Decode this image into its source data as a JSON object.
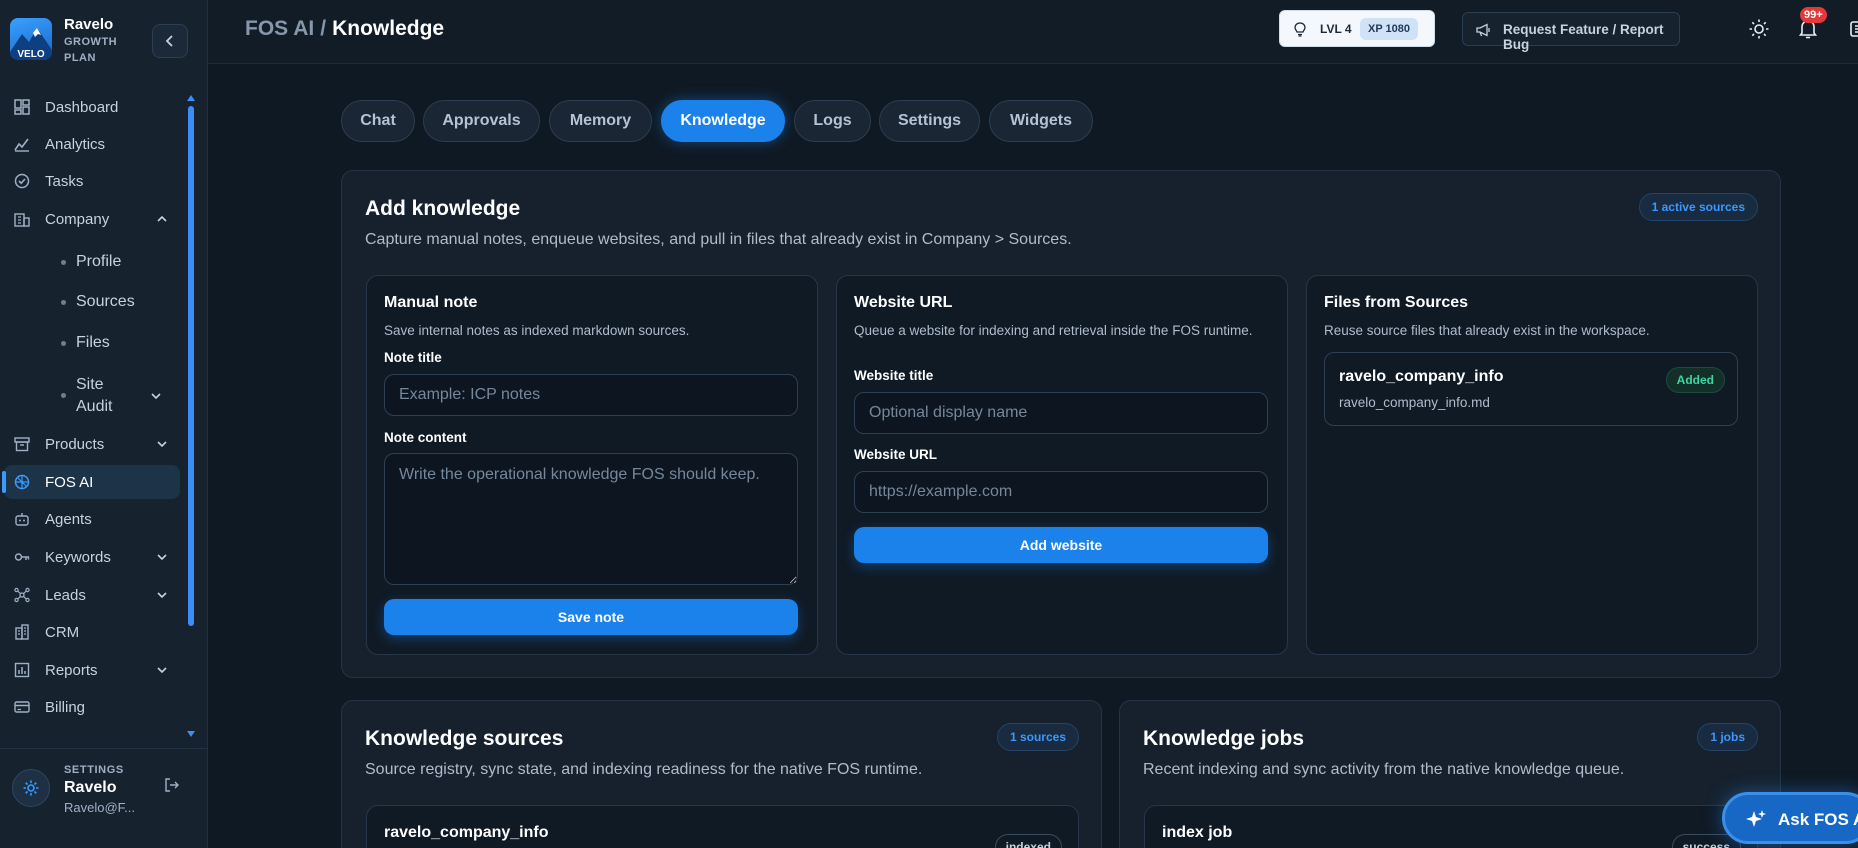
{
  "brand": {
    "name": "Ravelo",
    "plan": "GROWTH PLAN",
    "logo_text": "VELO"
  },
  "nav": {
    "items": [
      {
        "label": "Dashboard"
      },
      {
        "label": "Analytics"
      },
      {
        "label": "Tasks"
      },
      {
        "label": "Company"
      },
      {
        "label": "Products"
      },
      {
        "label": "FOS AI"
      },
      {
        "label": "Agents"
      },
      {
        "label": "Keywords"
      },
      {
        "label": "Leads"
      },
      {
        "label": "CRM"
      },
      {
        "label": "Reports"
      },
      {
        "label": "Billing"
      }
    ],
    "company_sub": [
      {
        "label": "Profile"
      },
      {
        "label": "Sources"
      },
      {
        "label": "Files"
      },
      {
        "label": "Site Audit"
      }
    ]
  },
  "user": {
    "section": "SETTINGS",
    "name": "Ravelo",
    "email": "Ravelo@F..."
  },
  "header": {
    "crumb_parent": "FOS AI",
    "crumb_sep": "/",
    "crumb_current": "Knowledge",
    "level": "LVL 4",
    "xp": "XP 1080",
    "request_label": "Request Feature / Report Bug",
    "notification_count": "99+"
  },
  "tabs": [
    {
      "label": "Chat"
    },
    {
      "label": "Approvals"
    },
    {
      "label": "Memory"
    },
    {
      "label": "Knowledge"
    },
    {
      "label": "Logs"
    },
    {
      "label": "Settings"
    },
    {
      "label": "Widgets"
    }
  ],
  "add_knowledge": {
    "title": "Add knowledge",
    "subtitle": "Capture manual notes, enqueue websites, and pull in files that already exist in Company > Sources.",
    "active_sources": "1 active sources",
    "manual_note": {
      "title": "Manual note",
      "subtitle": "Save internal notes as indexed markdown sources.",
      "note_title_label": "Note title",
      "note_title_placeholder": "Example: ICP notes",
      "note_content_label": "Note content",
      "note_content_placeholder": "Write the operational knowledge FOS should keep.",
      "save_label": "Save note"
    },
    "website": {
      "title": "Website URL",
      "subtitle": "Queue a website for indexing and retrieval inside the FOS runtime.",
      "title_label": "Website title",
      "title_placeholder": "Optional display name",
      "url_label": "Website URL",
      "url_placeholder": "https://example.com",
      "add_label": "Add website"
    },
    "files": {
      "title": "Files from Sources",
      "subtitle": "Reuse source files that already exist in the workspace.",
      "item_name": "ravelo_company_info",
      "item_file": "ravelo_company_info.md",
      "item_status": "Added"
    }
  },
  "knowledge_sources": {
    "title": "Knowledge sources",
    "subtitle": "Source registry, sync state, and indexing readiness for the native FOS runtime.",
    "count": "1 sources",
    "row_name": "ravelo_company_info",
    "row_status": "indexed"
  },
  "knowledge_jobs": {
    "title": "Knowledge jobs",
    "subtitle": "Recent indexing and sync activity from the native knowledge queue.",
    "count": "1 jobs",
    "row_name": "index job",
    "row_status": "success"
  },
  "ask_fab": {
    "label": "Ask FOS AI"
  }
}
